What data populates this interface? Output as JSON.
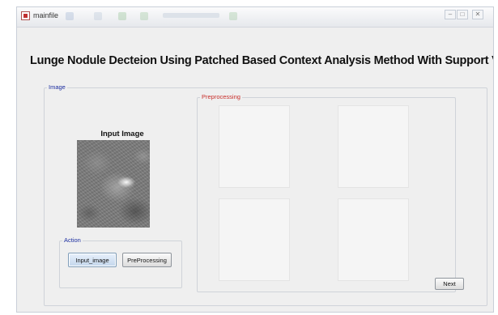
{
  "window": {
    "title": "mainfile"
  },
  "heading": "Lunge Nodule Decteion Using Patched Based Context Analysis Method With Support Vector Machin",
  "image_panel": {
    "legend": "Image",
    "input_image_label": "Input Image"
  },
  "preprocessing_panel": {
    "legend": "Preprocessing"
  },
  "action_panel": {
    "legend": "Action",
    "input_image_button": "Input_image",
    "preprocessing_button": "PreProcessing"
  },
  "next_button": "Next",
  "icons": {
    "app": "java-app-icon",
    "minimize": "minimize-icon",
    "maximize": "maximize-icon",
    "close": "close-icon"
  },
  "colors": {
    "group_legend": "#1c2ea0",
    "preprocessing_legend": "#c8302c",
    "window_background": "#efefef"
  }
}
